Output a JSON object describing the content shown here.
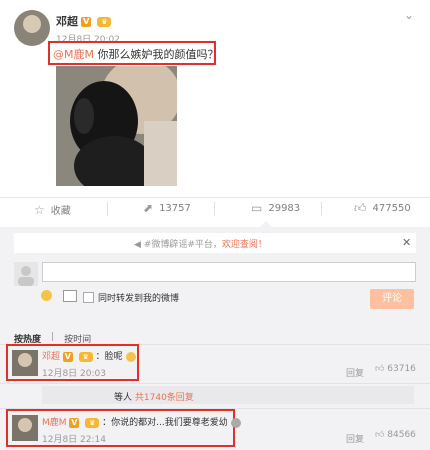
{
  "post": {
    "author": "邓超",
    "v_badge": "V",
    "time": "12月8日 20:02",
    "mention": "@M鹿M",
    "text": " 你那么嫉妒我的颜值吗？",
    "photo_description_label": ""
  },
  "actions": {
    "favorite": "收藏",
    "repost": "13757",
    "comment": "29983",
    "like": "477550"
  },
  "notice": {
    "text": "#微博辟谣#平台，",
    "link": "欢迎查阅！"
  },
  "composer": {
    "input_value": "",
    "checkbox_label": "同时转发到我的微博",
    "submit_label": "评论"
  },
  "sort": {
    "by_hot": "按热度",
    "by_time": "按时间"
  },
  "comments": [
    {
      "author": "邓超",
      "v_badge": "V",
      "text": "：脸呢",
      "time": "12月8日 20:03",
      "reply_label": "回复",
      "likes": "63716",
      "sub_prefix": "等人",
      "sub_link": "共1740条回复"
    },
    {
      "author": "M鹿M",
      "v_badge": "V",
      "text": "：你说的都对...我们要尊老爱幼",
      "time": "12月8日 22:14",
      "reply_label": "回复",
      "likes": "84566"
    }
  ],
  "colors": {
    "accent": "#eb7350",
    "highlight_border": "#e03028",
    "panel_bg": "#f2f2f5"
  }
}
